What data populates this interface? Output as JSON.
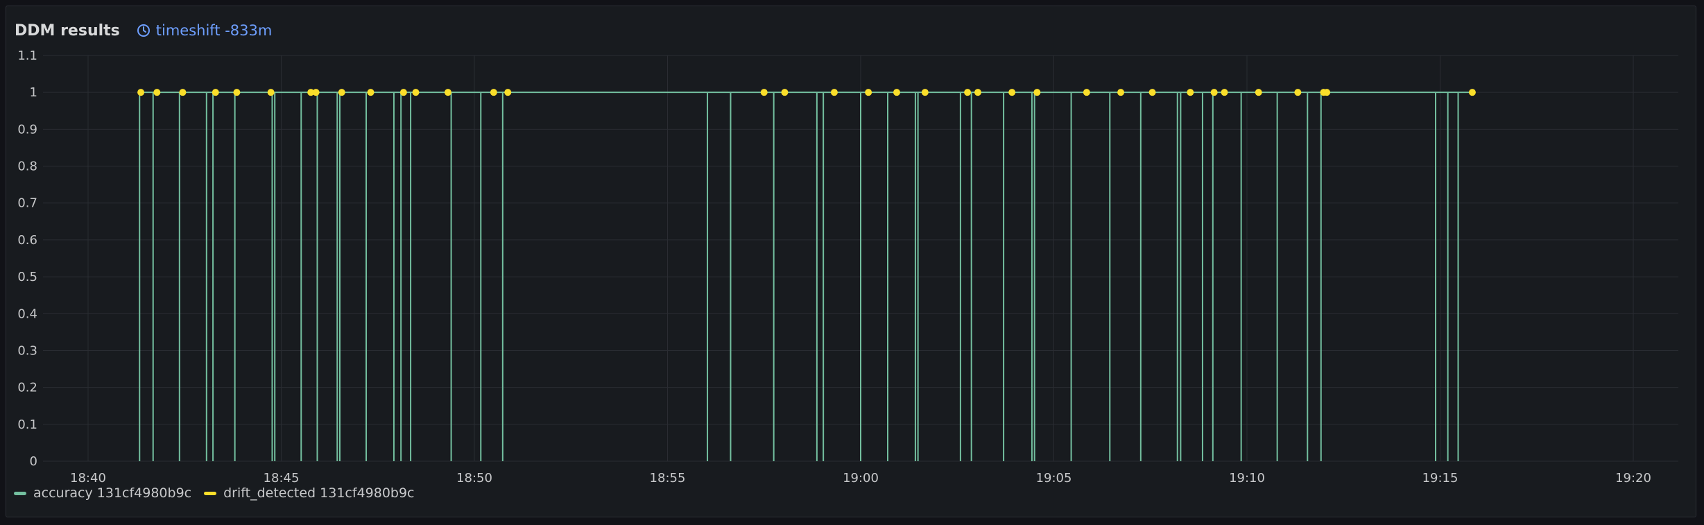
{
  "panel": {
    "title": "DDM results",
    "timeshift": "timeshift -833m"
  },
  "colors": {
    "accuracy": "#73bf9f",
    "drift": "#fade2a",
    "grid": "#2a2d33",
    "tick": "#c7c8ca"
  },
  "chart_data": {
    "type": "line",
    "title": "DDM results",
    "xlabel": "",
    "ylabel": "",
    "xlim": [
      "18:38:50",
      "19:21:10"
    ],
    "ylim": [
      0,
      1.1
    ],
    "yticks": [
      "0",
      "0.1",
      "0.2",
      "0.3",
      "0.4",
      "0.5",
      "0.6",
      "0.7",
      "0.8",
      "0.9",
      "1",
      "1.1"
    ],
    "xticks": [
      "18:40",
      "18:45",
      "18:50",
      "18:55",
      "19:00",
      "19:05",
      "19:10",
      "19:15",
      "19:20"
    ],
    "grid": true,
    "legend_position": "bottom-left",
    "series": [
      {
        "name": "accuracy 131cf4980b9c",
        "style": "line",
        "color": "#73bf9f",
        "range": [
          "18:41:20",
          "19:15:50"
        ],
        "value": 1,
        "dips_to_zero": [
          "18:41:20",
          "18:41:41",
          "18:42:22",
          "18:43:04",
          "18:43:14",
          "18:43:48",
          "18:44:46",
          "18:44:50",
          "18:45:31",
          "18:45:56",
          "18:46:27",
          "18:46:31",
          "18:47:12",
          "18:47:55",
          "18:48:06",
          "18:48:21",
          "18:49:24",
          "18:50:10",
          "18:50:44",
          "18:56:02",
          "18:56:38",
          "18:57:45",
          "18:58:52",
          "18:59:02",
          "19:00:00",
          "19:00:42",
          "19:01:25",
          "19:01:29",
          "19:02:35",
          "19:02:52",
          "19:03:42",
          "19:04:26",
          "19:04:30",
          "19:05:27",
          "19:06:27",
          "19:07:15",
          "19:08:12",
          "19:08:17",
          "19:08:51",
          "19:09:07",
          "19:09:51",
          "19:10:47",
          "19:11:34",
          "19:11:55",
          "19:14:53",
          "19:15:12",
          "19:15:28"
        ]
      },
      {
        "name": "drift_detected 131cf4980b9c",
        "style": "points",
        "color": "#fade2a",
        "value": 1,
        "x": [
          "18:41:22",
          "18:41:47",
          "18:42:27",
          "18:43:18",
          "18:43:51",
          "18:44:44",
          "18:45:46",
          "18:45:54",
          "18:46:34",
          "18:47:19",
          "18:48:10",
          "18:48:29",
          "18:49:19",
          "18:50:30",
          "18:50:52",
          "18:57:30",
          "18:58:02",
          "18:59:19",
          "19:00:12",
          "19:00:56",
          "19:01:40",
          "19:02:46",
          "19:03:02",
          "19:03:55",
          "19:04:34",
          "19:05:51",
          "19:06:44",
          "19:07:33",
          "19:08:32",
          "19:09:09",
          "19:09:25",
          "19:10:18",
          "19:11:19",
          "19:11:59",
          "19:12:04",
          "19:15:50"
        ]
      }
    ]
  }
}
